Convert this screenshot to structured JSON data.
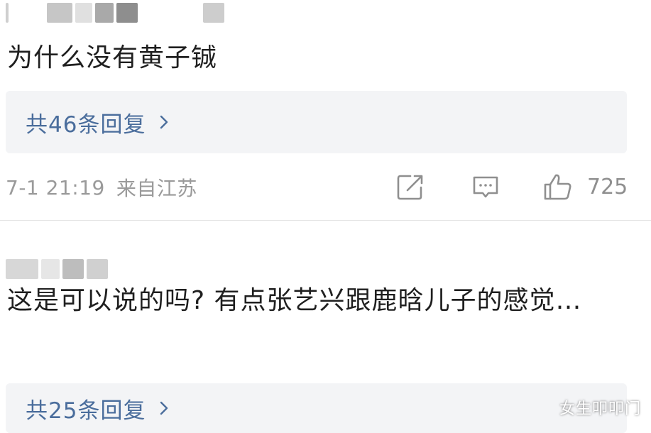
{
  "comments": [
    {
      "text": "为什么没有黄子铖",
      "replies_label": "共46条回复",
      "timestamp": "7-1 21:19",
      "location": "来自江苏",
      "likes": "725",
      "icons": [
        "share-icon",
        "reply-icon",
        "thumbs-up-icon",
        "chevron-right-icon"
      ]
    },
    {
      "text": "这是可以说的吗? 有点张艺兴跟鹿晗儿子的感觉…",
      "replies_label": "共25条回复"
    }
  ],
  "watermark": "女生叩叩门",
  "colors": {
    "reply_link": "#4a6d9c",
    "meta_gray": "#9a9a9a",
    "reply_box_bg": "#f3f4f6"
  }
}
